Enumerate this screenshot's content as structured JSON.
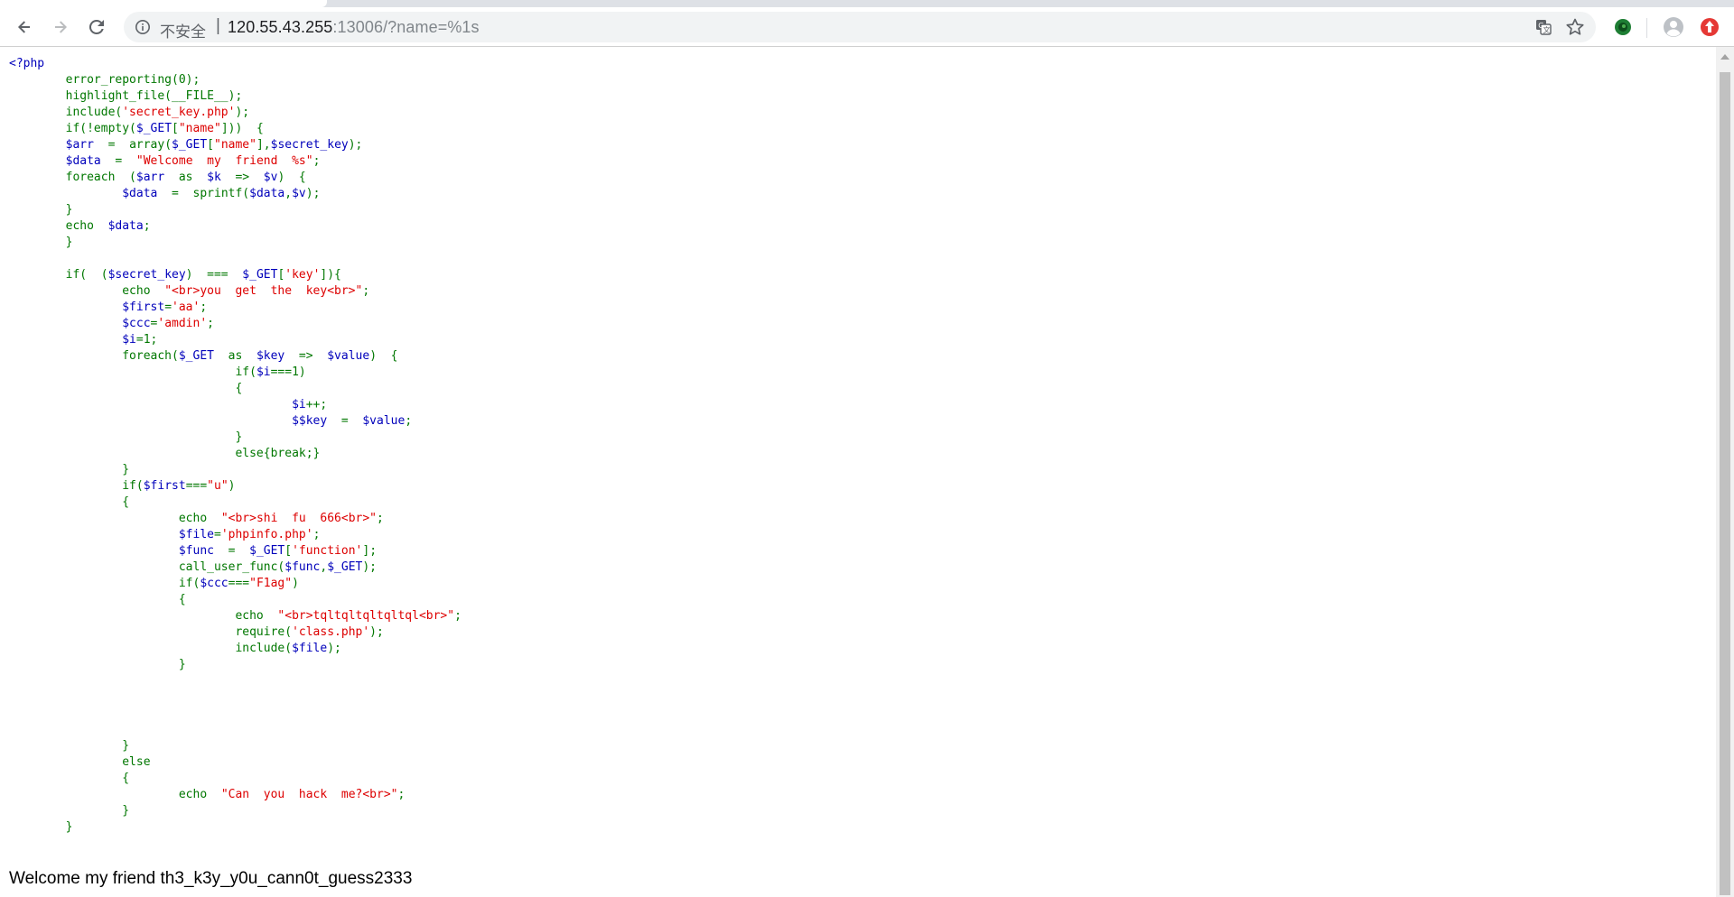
{
  "browser": {
    "security_label": "不安全",
    "separator": "|",
    "url_host": "120.55.43.255",
    "url_rest": ":13006/?name=%1s",
    "icons": {
      "back": "back-arrow-icon",
      "forward": "forward-arrow-icon",
      "reload": "reload-icon",
      "info": "info-icon",
      "translate": "translate-icon",
      "star": "star-icon",
      "extension1": "extension-green-icon",
      "avatar": "profile-avatar-icon",
      "extension2": "extension-red-icon"
    },
    "colors": {
      "ext1": "#1e7e34",
      "ext2": "#e53935",
      "avatar": "#bdc1c6"
    }
  },
  "page": {
    "source_lines": [
      "<?php",
      "        error_reporting(0);",
      "        highlight_file(__FILE__);",
      "        include('secret_key.php');",
      "        if(!empty($_GET[\"name\"]))  {",
      "        $arr  =  array($_GET[\"name\"],$secret_key);",
      "        $data  =  \"Welcome  my  friend  %s\";",
      "        foreach  ($arr  as  $k  =>  $v)  {",
      "                $data  =  sprintf($data,$v);",
      "        }",
      "        echo  $data;",
      "        }",
      "",
      "        if(  ($secret_key)  ===  $_GET['key']){",
      "                echo  \"<br>you  get  the  key<br>\";",
      "                $first='aa';",
      "                $ccc='amdin';",
      "                $i=1;",
      "                foreach($_GET  as  $key  =>  $value)  {",
      "                                if($i===1)",
      "                                {",
      "                                        $i++;",
      "                                        $$key  =  $value;",
      "                                }",
      "                                else{break;}",
      "                }",
      "                if($first===\"u\")",
      "                {",
      "                        echo  \"<br>shi  fu  666<br>\";",
      "                        $file='phpinfo.php';",
      "                        $func  =  $_GET['function'];",
      "                        call_user_func($func,$_GET);",
      "                        if($ccc===\"F1ag\")",
      "                        {",
      "                                echo  \"<br>tqltqltqltqltql<br>\";",
      "                                require('class.php');",
      "                                include($file);",
      "                        }",
      "",
      "",
      "",
      "",
      "                }",
      "                else",
      "                {",
      "                        echo  \"Can  you  hack  me?<br>\";",
      "                }",
      "        }"
    ],
    "output_text": "Welcome my friend th3_k3y_y0u_cann0t_guess2333"
  }
}
